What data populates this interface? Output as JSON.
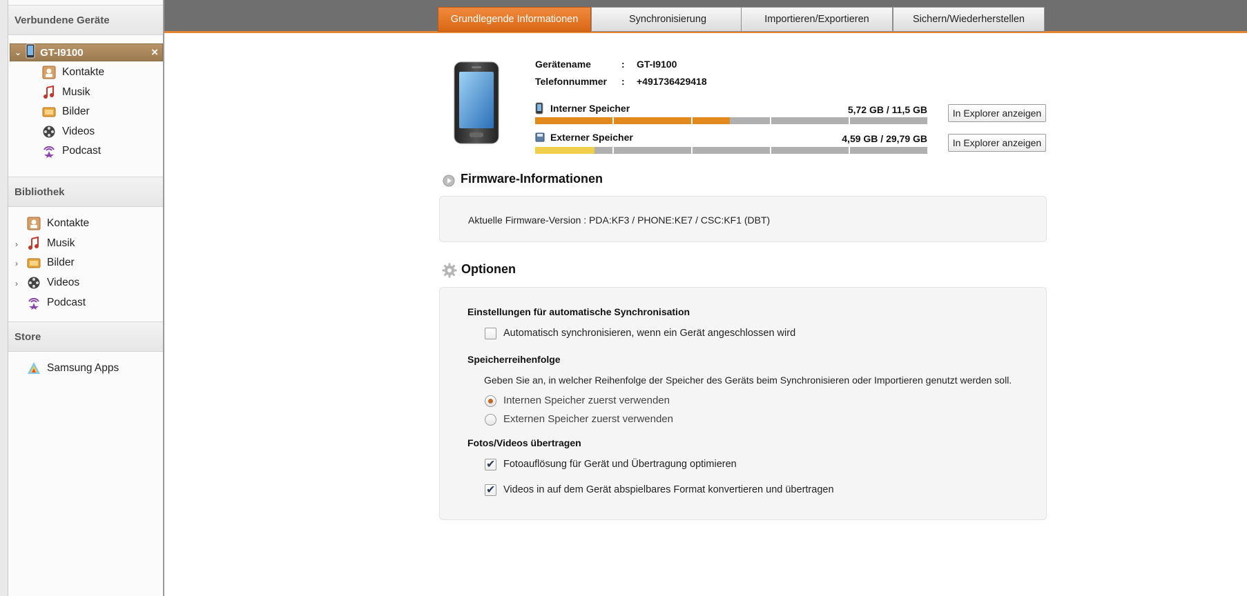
{
  "sidebar": {
    "connected_header": "Verbundene Geräte",
    "device": {
      "name": "GT-I9100",
      "close": "×"
    },
    "device_items": [
      {
        "label": "Kontakte",
        "icon": "contacts-icon"
      },
      {
        "label": "Musik",
        "icon": "music-icon"
      },
      {
        "label": "Bilder",
        "icon": "pictures-icon"
      },
      {
        "label": "Videos",
        "icon": "videos-icon"
      },
      {
        "label": "Podcast",
        "icon": "podcast-icon"
      }
    ],
    "library_header": "Bibliothek",
    "library_items": [
      {
        "label": "Kontakte",
        "icon": "contacts-icon",
        "expandable": false
      },
      {
        "label": "Musik",
        "icon": "music-icon",
        "expandable": true
      },
      {
        "label": "Bilder",
        "icon": "pictures-icon",
        "expandable": true
      },
      {
        "label": "Videos",
        "icon": "videos-icon",
        "expandable": true
      },
      {
        "label": "Podcast",
        "icon": "podcast-icon",
        "expandable": false
      }
    ],
    "store_header": "Store",
    "store_items": [
      {
        "label": "Samsung Apps",
        "icon": "samsung-apps-icon"
      }
    ]
  },
  "tabs": [
    {
      "label": "Grundlegende Informationen",
      "active": true
    },
    {
      "label": "Synchronisierung",
      "active": false
    },
    {
      "label": "Importieren/Exportieren",
      "active": false
    },
    {
      "label": "Sichern/Wiederherstellen",
      "active": false
    }
  ],
  "device_info": {
    "name_label": "Gerätename",
    "name_value": "GT-I9100",
    "phone_label": "Telefonnummer",
    "phone_value": "+491736429418",
    "colon": ":"
  },
  "storage": {
    "internal": {
      "label": "Interner Speicher",
      "usage": "5,72 GB / 11,5 GB",
      "fraction": 0.497,
      "color": "#e08a1e",
      "button": "In Explorer anzeigen"
    },
    "external": {
      "label": "Externer Speicher",
      "usage": "4,59 GB / 29,79 GB",
      "fraction": 0.154,
      "color": "#f0cf4a",
      "button": "In Explorer anzeigen"
    }
  },
  "firmware": {
    "title": "Firmware-Informationen",
    "text": "Aktuelle Firmware-Version : PDA:KF3 / PHONE:KE7 / CSC:KF1 (DBT)"
  },
  "options": {
    "title": "Optionen",
    "autosync_head": "Einstellungen für automatische Synchronisation",
    "autosync_label": "Automatisch synchronisieren, wenn ein Gerät angeschlossen wird",
    "autosync_checked": false,
    "order_head": "Speicherreihenfolge",
    "order_desc": "Geben Sie an, in welcher Reihenfolge der Speicher des Geräts beim Synchronisieren oder Importieren genutzt werden soll.",
    "order_internal": "Internen Speicher zuerst verwenden",
    "order_external": "Externen Speicher zuerst verwenden",
    "order_selected": "internal",
    "media_head": "Fotos/Videos übertragen",
    "photo_label": "Fotoauflösung für Gerät und Übertragung optimieren",
    "photo_checked": true,
    "video_label": "Videos in auf dem Gerät abspielbares Format konvertieren und übertragen",
    "video_checked": true
  }
}
